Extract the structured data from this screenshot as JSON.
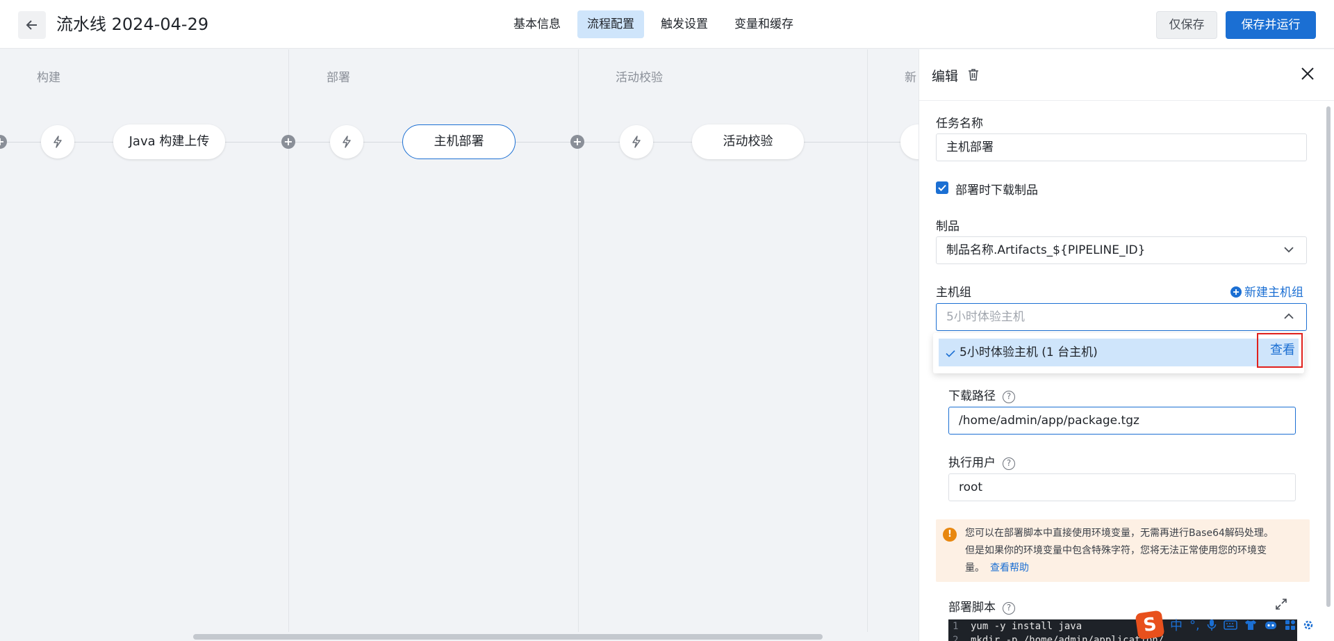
{
  "header": {
    "back_icon": "arrow-left-icon",
    "title": "流水线 2024-04-29",
    "tabs": [
      {
        "label": "基本信息",
        "active": false
      },
      {
        "label": "流程配置",
        "active": true
      },
      {
        "label": "触发设置",
        "active": false
      },
      {
        "label": "变量和缓存",
        "active": false
      }
    ],
    "save_only_label": "仅保存",
    "save_run_label": "保存并运行"
  },
  "canvas": {
    "stages": [
      {
        "title": "构建",
        "job": "Java 构建上传"
      },
      {
        "title": "部署",
        "job": "主机部署"
      },
      {
        "title": "活动校验",
        "job": "活动校验"
      },
      {
        "title": "新",
        "job": ""
      }
    ]
  },
  "panel": {
    "title": "编辑",
    "task_name_label": "任务名称",
    "task_name_value": "主机部署",
    "download_checkbox_label": "部署时下载制品",
    "download_checked": true,
    "artifact_label": "制品",
    "artifact_value": "制品名称.Artifacts_${PIPELINE_ID}",
    "host_group_label": "主机组",
    "new_host_group_label": "新建主机组",
    "host_group_placeholder": "5小时体验主机",
    "host_group_option": "5小时体验主机 (1 台主机)",
    "view_label": "查看",
    "download_path_label": "下载路径",
    "download_path_value": "/home/admin/app/package.tgz",
    "exec_user_label": "执行用户",
    "exec_user_value": "root",
    "alert": {
      "line1": "您可以在部署脚本中直接使用环境变量，无需再进行Base64解码处理。",
      "line2": "但是如果你的环境变量中包含特殊字符，您将无法正常使用您的环境变",
      "line3": "量。",
      "link": "查看帮助"
    },
    "script_label": "部署脚本",
    "script_lines": [
      {
        "n": "1",
        "text": "yum -y install java"
      },
      {
        "n": "2",
        "text": "mkdir -p /home/admin/application/"
      }
    ]
  },
  "ime": {
    "logo": "S",
    "items": [
      "中",
      "°,",
      "mic-icon",
      "keyboard-icon",
      "shirt-icon",
      "robot-icon",
      "grid-icon",
      "settings-icon"
    ]
  },
  "colors": {
    "accent": "#1b6fd3",
    "tab_active_bg": "#cfe5fb",
    "highlight": "#e0201c",
    "alert_bg": "#fdf0e4"
  }
}
